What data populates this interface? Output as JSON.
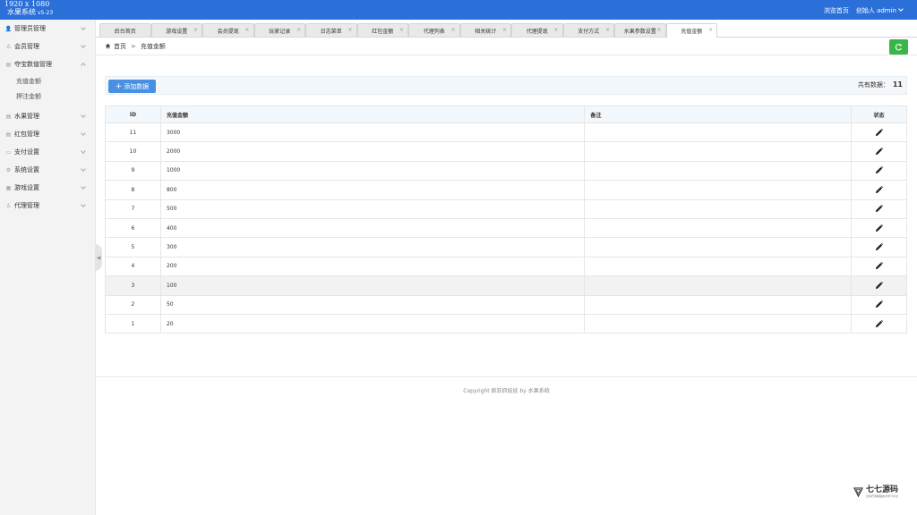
{
  "resolution_label": "1920 x 1080",
  "brand": {
    "name": "水果系统",
    "version": "v5-23"
  },
  "topbar": {
    "preview": "浏览首页",
    "role": "创始人",
    "user": "admin"
  },
  "sidebar": {
    "items": [
      {
        "label": "管理员管理",
        "icon": "user-icon"
      },
      {
        "label": "会员管理",
        "icon": "member-icon"
      },
      {
        "label": "夺宝数值管理",
        "icon": "database-icon",
        "expanded": true,
        "children": [
          "充值金额",
          "押注金额"
        ]
      },
      {
        "label": "水果管理",
        "icon": "fruit-icon"
      },
      {
        "label": "红包管理",
        "icon": "red-packet-icon"
      },
      {
        "label": "支付设置",
        "icon": "card-icon"
      },
      {
        "label": "系统设置",
        "icon": "gear-icon"
      },
      {
        "label": "游戏设置",
        "icon": "game-icon"
      },
      {
        "label": "代理管理",
        "icon": "agent-icon"
      }
    ]
  },
  "tabs": [
    "后台首页",
    "游戏设置",
    "会员提现",
    "玩家记录",
    "日志菜单",
    "红包金额",
    "代理列表",
    "相关统计",
    "代理提现",
    "支付方式",
    "水果参数设置",
    "充值金额"
  ],
  "active_tab": 11,
  "breadcrumb": {
    "home": "首页",
    "current": "充值金额"
  },
  "toolbar": {
    "add_label": "添加数据",
    "total_label": "共有数据：",
    "total": "11"
  },
  "table": {
    "headers": {
      "id": "ID",
      "amount": "充值金额",
      "note": "备注",
      "status": "状态"
    },
    "rows": [
      {
        "id": "11",
        "amount": "3000",
        "note": ""
      },
      {
        "id": "10",
        "amount": "2000",
        "note": ""
      },
      {
        "id": "9",
        "amount": "1000",
        "note": ""
      },
      {
        "id": "8",
        "amount": "800",
        "note": ""
      },
      {
        "id": "7",
        "amount": "500",
        "note": ""
      },
      {
        "id": "6",
        "amount": "400",
        "note": ""
      },
      {
        "id": "5",
        "amount": "300",
        "note": ""
      },
      {
        "id": "4",
        "amount": "200",
        "note": ""
      },
      {
        "id": "3",
        "amount": "100",
        "note": ""
      },
      {
        "id": "2",
        "amount": "50",
        "note": ""
      },
      {
        "id": "1",
        "amount": "20",
        "note": ""
      }
    ],
    "highlight_row": 8
  },
  "footer": "Copyright 疯狂抓娃娃 by 水果系统",
  "watermark": {
    "name": "七七源码",
    "sub": "全球开源网络技术学习平台"
  },
  "colors": {
    "topbar": "#2b6fd8",
    "add_button": "#4a90e2",
    "refresh_button": "#39b54a"
  }
}
